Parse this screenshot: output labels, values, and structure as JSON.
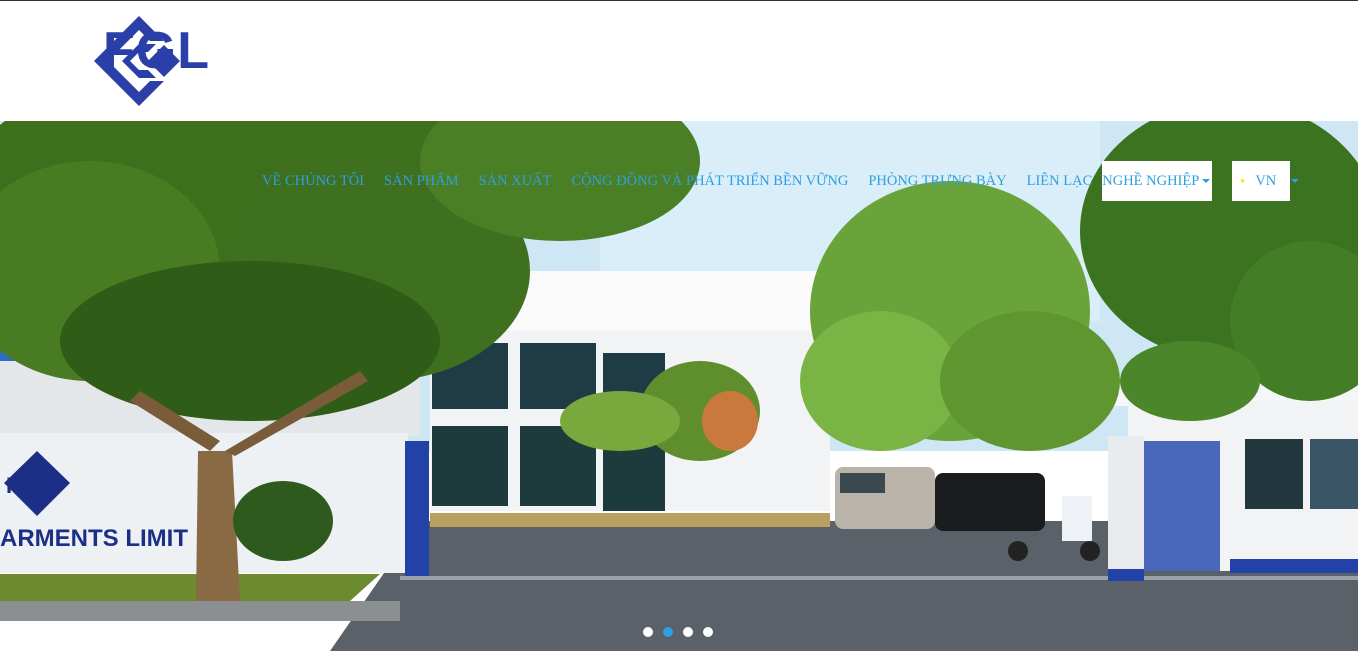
{
  "brand": {
    "name": "FGL",
    "sign_line1": "FGL",
    "sign_line2": "ARMENTS LIMIT"
  },
  "nav": {
    "items": [
      {
        "label": "VỀ CHÚNG TÔI"
      },
      {
        "label": "SẢN PHẨM"
      },
      {
        "label": "SẢN XUẤT"
      },
      {
        "label": "CỘNG ĐỒNG VÀ PHÁT TRIỂN BỀN VỮNG"
      },
      {
        "label": "PHÒNG TRƯNG BÀY"
      },
      {
        "label": "LIÊN LẠC"
      }
    ],
    "careers": {
      "label": "NGHỀ NGHIỆP"
    },
    "language": {
      "label": "VN",
      "flag_icon": "vietnam-flag-icon"
    }
  },
  "slider": {
    "slide_count": 4,
    "active_index": 1
  },
  "colors": {
    "brand_blue": "#2b3fa8",
    "nav_blue": "#2f9fe0"
  }
}
